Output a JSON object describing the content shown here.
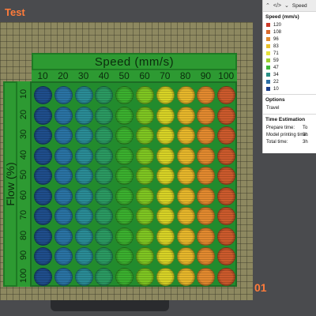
{
  "plate": {
    "title": "Test",
    "plate_number": "01"
  },
  "test_print": {
    "speed_label": "Speed (mm/s)",
    "flow_label": "Flow (%)",
    "speed_ticks": [
      "10",
      "20",
      "30",
      "40",
      "50",
      "60",
      "70",
      "80",
      "90",
      "100"
    ],
    "flow_ticks": [
      "10",
      "20",
      "30",
      "40",
      "50",
      "60",
      "70",
      "80",
      "90",
      "100"
    ],
    "disc_colors_by_column": [
      "#1f4e8c",
      "#2a73a4",
      "#2a8c96",
      "#2b9a62",
      "#3bb02f",
      "#7fc622",
      "#d8d326",
      "#e7b72b",
      "#e38a2f",
      "#cc5a2c"
    ]
  },
  "panel": {
    "header": {
      "collapse_icon": "chevron-up-icon",
      "code_icon": "code-icon",
      "dropdown_icon": "chevron-down-icon",
      "view_label": "Speed"
    },
    "legend_title": "Speed (mm/s)",
    "legend": [
      {
        "value": "120",
        "color": "#cc3b2a"
      },
      {
        "value": "108",
        "color": "#d96a2c"
      },
      {
        "value": "96",
        "color": "#e08b2e"
      },
      {
        "value": "83",
        "color": "#e9c12b"
      },
      {
        "value": "71",
        "color": "#e6e23a"
      },
      {
        "value": "59",
        "color": "#9ed02e"
      },
      {
        "value": "47",
        "color": "#3fb63a"
      },
      {
        "value": "34",
        "color": "#2a8f86"
      },
      {
        "value": "22",
        "color": "#2b6fa6"
      },
      {
        "value": "10",
        "color": "#1c3f8a"
      }
    ],
    "options_title": "Options",
    "options": [
      "Travel"
    ],
    "time_title": "Time Estimation",
    "time_rows": [
      {
        "label": "Prepare time:",
        "value": "To"
      },
      {
        "label": "Model printing time:",
        "value": "3h"
      },
      {
        "label": "Total time:",
        "value": "3h"
      }
    ]
  }
}
